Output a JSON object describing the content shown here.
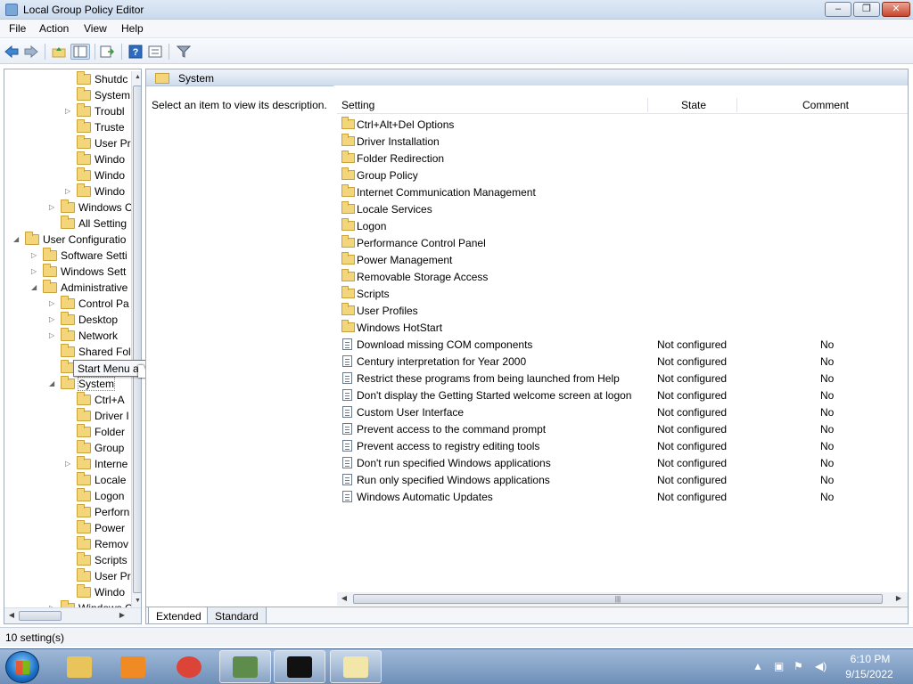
{
  "window": {
    "title": "Local Group Policy Editor",
    "min": "‒",
    "max": "❐",
    "close": "✕"
  },
  "menu": [
    "File",
    "Action",
    "View",
    "Help"
  ],
  "toolbar": {
    "icons": [
      "back-arrow-icon",
      "forward-arrow-icon",
      "up-folder-icon",
      "show-hide-tree-icon",
      "export-list-icon",
      "help-icon",
      "properties-icon",
      "filter-icon"
    ]
  },
  "tree": {
    "items": [
      {
        "label": "Shutdc",
        "indent": 4,
        "expander": ""
      },
      {
        "label": "System",
        "indent": 4,
        "expander": ""
      },
      {
        "label": "Troubl",
        "indent": 4,
        "expander": "▷"
      },
      {
        "label": "Truste",
        "indent": 4,
        "expander": ""
      },
      {
        "label": "User Pr",
        "indent": 4,
        "expander": ""
      },
      {
        "label": "Windo",
        "indent": 4,
        "expander": ""
      },
      {
        "label": "Windo",
        "indent": 4,
        "expander": ""
      },
      {
        "label": "Windo",
        "indent": 4,
        "expander": "▷"
      },
      {
        "label": "Windows C",
        "indent": 3,
        "expander": "▷"
      },
      {
        "label": "All Setting",
        "indent": 3,
        "expander": ""
      },
      {
        "label": "User Configuratio",
        "indent": 1,
        "expander": "◢"
      },
      {
        "label": "Software Setti",
        "indent": 2,
        "expander": "▷"
      },
      {
        "label": "Windows Sett",
        "indent": 2,
        "expander": "▷"
      },
      {
        "label": "Administrative",
        "indent": 2,
        "expander": "◢"
      },
      {
        "label": "Control Pa",
        "indent": 3,
        "expander": "▷"
      },
      {
        "label": "Desktop",
        "indent": 3,
        "expander": "▷"
      },
      {
        "label": "Network",
        "indent": 3,
        "expander": "▷"
      },
      {
        "label": "Shared Fol",
        "indent": 3,
        "expander": ""
      },
      {
        "label": "Start Menu and Taskbar",
        "indent": 3,
        "expander": ""
      },
      {
        "label": "System",
        "indent": 3,
        "expander": "◢"
      },
      {
        "label": "Ctrl+A",
        "indent": 4,
        "expander": ""
      },
      {
        "label": "Driver I",
        "indent": 4,
        "expander": ""
      },
      {
        "label": "Folder",
        "indent": 4,
        "expander": ""
      },
      {
        "label": "Group",
        "indent": 4,
        "expander": ""
      },
      {
        "label": "Interne",
        "indent": 4,
        "expander": "▷"
      },
      {
        "label": "Locale",
        "indent": 4,
        "expander": ""
      },
      {
        "label": "Logon",
        "indent": 4,
        "expander": ""
      },
      {
        "label": "Perforn",
        "indent": 4,
        "expander": ""
      },
      {
        "label": "Power",
        "indent": 4,
        "expander": ""
      },
      {
        "label": "Remov",
        "indent": 4,
        "expander": ""
      },
      {
        "label": "Scripts",
        "indent": 4,
        "expander": ""
      },
      {
        "label": "User Pr",
        "indent": 4,
        "expander": ""
      },
      {
        "label": "Windo",
        "indent": 4,
        "expander": ""
      },
      {
        "label": "Windows C",
        "indent": 3,
        "expander": "▷"
      }
    ]
  },
  "tooltip": "Start Menu and Taskbar",
  "right": {
    "header": "System",
    "description": "Select an item to view its description.",
    "columns": {
      "setting": "Setting",
      "state": "State",
      "comment": "Comment"
    },
    "folders": [
      "Ctrl+Alt+Del Options",
      "Driver Installation",
      "Folder Redirection",
      "Group Policy",
      "Internet Communication Management",
      "Locale Services",
      "Logon",
      "Performance Control Panel",
      "Power Management",
      "Removable Storage Access",
      "Scripts",
      "User Profiles",
      "Windows HotStart"
    ],
    "policies": [
      {
        "name": "Download missing COM components",
        "state": "Not configured",
        "comment": "No"
      },
      {
        "name": "Century interpretation for Year 2000",
        "state": "Not configured",
        "comment": "No"
      },
      {
        "name": "Restrict these programs from being launched from Help",
        "state": "Not configured",
        "comment": "No"
      },
      {
        "name": "Don't display the Getting Started welcome screen at logon",
        "state": "Not configured",
        "comment": "No"
      },
      {
        "name": "Custom User Interface",
        "state": "Not configured",
        "comment": "No"
      },
      {
        "name": "Prevent access to the command prompt",
        "state": "Not configured",
        "comment": "No"
      },
      {
        "name": "Prevent access to registry editing tools",
        "state": "Not configured",
        "comment": "No"
      },
      {
        "name": "Don't run specified Windows applications",
        "state": "Not configured",
        "comment": "No"
      },
      {
        "name": "Run only specified Windows applications",
        "state": "Not configured",
        "comment": "No"
      },
      {
        "name": "Windows Automatic Updates",
        "state": "Not configured",
        "comment": "No"
      }
    ],
    "tabs": {
      "extended": "Extended",
      "standard": "Standard"
    }
  },
  "status": "10 setting(s)",
  "taskbar": {
    "apps": [
      {
        "name": "file-explorer-icon",
        "color": "#e9c45a",
        "running": false
      },
      {
        "name": "media-player-icon",
        "color": "#f08a24",
        "running": false
      },
      {
        "name": "chrome-icon",
        "color": "#db4437",
        "running": false
      },
      {
        "name": "system-monitor-icon",
        "color": "#5e8c4a",
        "running": true
      },
      {
        "name": "command-prompt-icon",
        "color": "#111111",
        "running": true
      },
      {
        "name": "notepad-icon",
        "color": "#f2e6a8",
        "running": true
      }
    ],
    "time": "6:10 PM",
    "date": "9/15/2022"
  },
  "colors": {
    "accent": "#c9daee",
    "taskbar": "#7d9cc4"
  }
}
